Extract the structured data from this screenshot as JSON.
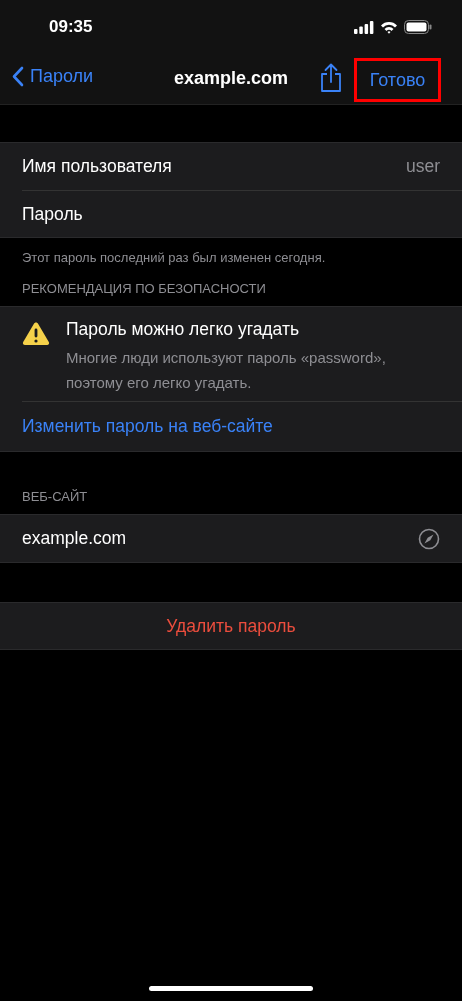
{
  "status_bar": {
    "time": "09:35"
  },
  "nav_bar": {
    "back": "Пароли",
    "title": "example.com",
    "done": {
      "label": "Готово",
      "highlighted": true
    }
  },
  "account": {
    "rows": [
      {
        "label": "Имя пользователя",
        "value": "user"
      },
      {
        "label": "Пароль"
      }
    ],
    "note": "Этот пароль последний раз был изменен сегодня."
  },
  "security": {
    "header": "РЕКОМЕНДАЦИЯ ПО БЕЗОПАСНОСТИ",
    "warning": {
      "title": "Пароль можно легко угадать",
      "text": "Многие люди используют пароль «password», поэтому его легко угадать."
    },
    "link": "Изменить пароль на веб-сайте"
  },
  "website": {
    "header": "ВЕБ-САЙТ",
    "url": "example.com"
  },
  "delete_button": "Удалить пароль"
}
